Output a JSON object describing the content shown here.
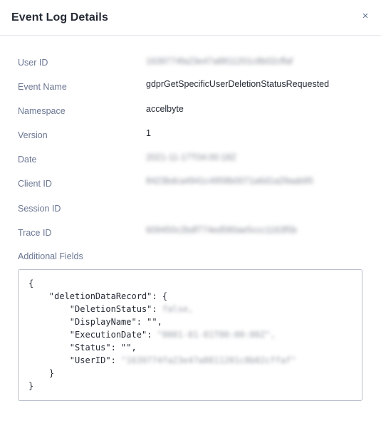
{
  "modal": {
    "title": "Event Log Details",
    "close_icon": "×"
  },
  "fields": [
    {
      "label": "User ID",
      "value": "1639774fa23e47a8811201c8b02cffaf",
      "redacted": true
    },
    {
      "label": "Event Name",
      "value": "gdprGetSpecificUserDeletionStatusRequested",
      "redacted": false
    },
    {
      "label": "Namespace",
      "value": "accelbyte",
      "redacted": false
    },
    {
      "label": "Version",
      "value": "1",
      "redacted": false
    },
    {
      "label": "Date",
      "value": "2021-11-17T04:00:18Z",
      "redacted": true
    },
    {
      "label": "Client ID",
      "value": "8423bdca4941c4958b0071a6d1a29aab95",
      "redacted": true
    },
    {
      "label": "Session ID",
      "value": "",
      "redacted": false
    },
    {
      "label": "Trace ID",
      "value": "609450c2bdf774ed580ae5ccc1163f5b",
      "redacted": true
    }
  ],
  "additional_fields": {
    "label": "Additional Fields",
    "lines": {
      "l1": "{",
      "l2": "    \"deletionDataRecord\": {",
      "l3_key": "        \"DeletionStatus\": ",
      "l3_val": "false,",
      "l4": "        \"DisplayName\": \"\",",
      "l5_key": "        \"ExecutionDate\": ",
      "l5_val": "\"0001-01-01T00:00:00Z\",",
      "l6": "        \"Status\": \"\",",
      "l7_key": "        \"UserID\": ",
      "l7_val": "\"1639774fa23e47a8811201c8b02cffaf\"",
      "l8": "    }",
      "l9": "}"
    }
  }
}
